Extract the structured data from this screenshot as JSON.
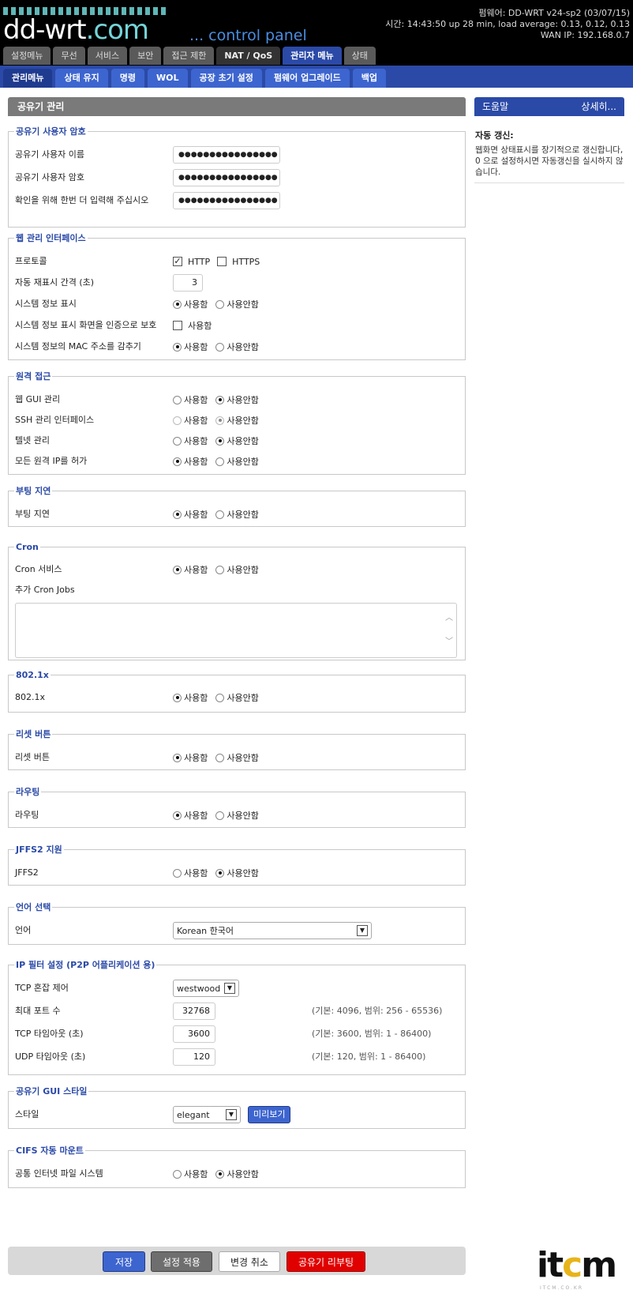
{
  "header": {
    "logo_main": "dd-wrt",
    "logo_ext": ".com",
    "tagline": "... control panel",
    "firmware": "펌웨어: DD-WRT v24-sp2 (03/07/15)",
    "time": "시간: 14:43:50 up 28 min, load average: 0.13, 0.12, 0.13",
    "wan_ip": "WAN IP: 192.168.0.7"
  },
  "nav1": [
    "설정메뉴",
    "무선",
    "서비스",
    "보안",
    "접근 제한",
    "NAT / QoS",
    "관리자 메뉴",
    "상태"
  ],
  "nav2": [
    "관리메뉴",
    "상태 유지",
    "명령",
    "WOL",
    "공장 초기 설정",
    "펌웨어 업그레이드",
    "백업"
  ],
  "main_title": "공유기 관리",
  "help": {
    "title": "도움말",
    "more": "상세히...",
    "item_title": "자동 갱신:",
    "item_text": "웹화면 상태표시를 장기적으로 갱신합니다, 0 으로 설정하시면 자동갱신을 실시하지 않습니다."
  },
  "labels": {
    "enable": "사용함",
    "disable": "사용안함"
  },
  "password": {
    "legend": "공유기 사용자 암호",
    "username_label": "공유기 사용자 이름",
    "password_label": "공유기 사용자 암호",
    "confirm_label": "확인을 위해 한번 더 입력해 주십시오",
    "masked": "●●●●●●●●●●●●●●●●"
  },
  "web": {
    "legend": "웹 관리 인터페이스",
    "protocol_label": "프로토콜",
    "http": "HTTP",
    "https": "HTTPS",
    "refresh_label": "자동 재표시 간격 (초)",
    "refresh_value": "3",
    "sysinfo_label": "시스템 정보 표시",
    "protect_label": "시스템 정보 표시 화면을 인증으로 보호",
    "mac_label": "시스템 정보의 MAC 주소를 감추기"
  },
  "remote": {
    "legend": "원격 접근",
    "webgui_label": "웹 GUI 관리",
    "ssh_label": "SSH 관리 인터페이스",
    "telnet_label": "텔넷 관리",
    "allip_label": "모든 원격 IP를 허가"
  },
  "boot": {
    "legend": "부팅 지연",
    "label": "부팅 지연"
  },
  "cron": {
    "legend": "Cron",
    "service_label": "Cron 서비스",
    "jobs_label": "추가 Cron Jobs",
    "jobs_value": ""
  },
  "dot1x": {
    "legend": "802.1x",
    "label": "802.1x"
  },
  "reset": {
    "legend": "리셋 버튼",
    "label": "리셋 버튼"
  },
  "routing": {
    "legend": "라우팅",
    "label": "라우팅"
  },
  "jffs2": {
    "legend": "JFFS2 지원",
    "label": "JFFS2"
  },
  "language": {
    "legend": "언어 선택",
    "label": "언어",
    "value": "Korean 한국어"
  },
  "ipfilter": {
    "legend": "IP 필터 설정 (P2P 어플리케이션 용)",
    "tcp_cc_label": "TCP 혼잡 제어",
    "tcp_cc_value": "westwood",
    "max_ports_label": "최대 포트 수",
    "max_ports_value": "32768",
    "max_ports_hint": "(기본: 4096, 범위: 256 - 65536)",
    "tcp_timeout_label": "TCP 타임아웃 (초)",
    "tcp_timeout_value": "3600",
    "tcp_timeout_hint": "(기본: 3600, 범위: 1 - 86400)",
    "udp_timeout_label": "UDP 타임아웃 (초)",
    "udp_timeout_value": "120",
    "udp_timeout_hint": "(기본: 120, 범위: 1 - 86400)"
  },
  "gui_style": {
    "legend": "공유기 GUI 스타일",
    "label": "스타일",
    "value": "elegant",
    "preview": "미리보기"
  },
  "cifs": {
    "legend": "CIFS 자동 마운트",
    "label": "공통 인터넷 파일 시스템"
  },
  "buttons": {
    "save": "저장",
    "apply": "설정 적용",
    "cancel": "변경 취소",
    "reboot": "공유기 리부팅"
  },
  "watermark": {
    "brand": "itcm",
    "sub": "ITCM.CO.KR"
  },
  "colors": {
    "accent": "#2b4aa7",
    "reboot": "#e00000",
    "save": "#3d65cf"
  }
}
